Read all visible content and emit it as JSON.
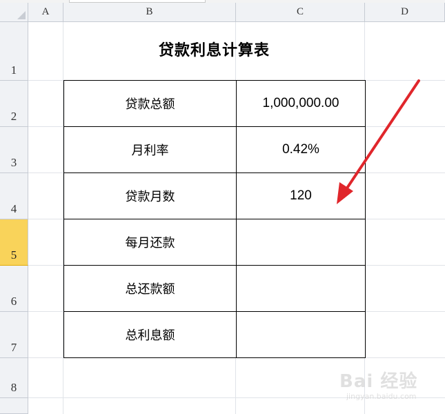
{
  "columns": [
    "A",
    "B",
    "C",
    "D"
  ],
  "rows": [
    "1",
    "2",
    "3",
    "4",
    "5",
    "6",
    "7",
    "8"
  ],
  "selected_row": "5",
  "title": "贷款利息计算表",
  "table": [
    {
      "label": "贷款总额",
      "value": "1,000,000.00"
    },
    {
      "label": "月利率",
      "value": "0.42%"
    },
    {
      "label": "贷款月数",
      "value": "120"
    },
    {
      "label": "每月还款",
      "value": ""
    },
    {
      "label": "总还款额",
      "value": ""
    },
    {
      "label": "总利息额",
      "value": ""
    }
  ],
  "annotation": {
    "icon": "red-arrow-icon",
    "color": "#e0262b"
  },
  "watermark": {
    "main": "Bai 经验",
    "sub": "jingyan.baidu.com"
  },
  "colors": {
    "header_bg": "#f0f2f5",
    "selected_header": "#f9d35a",
    "gridline": "#e0e3e8"
  }
}
